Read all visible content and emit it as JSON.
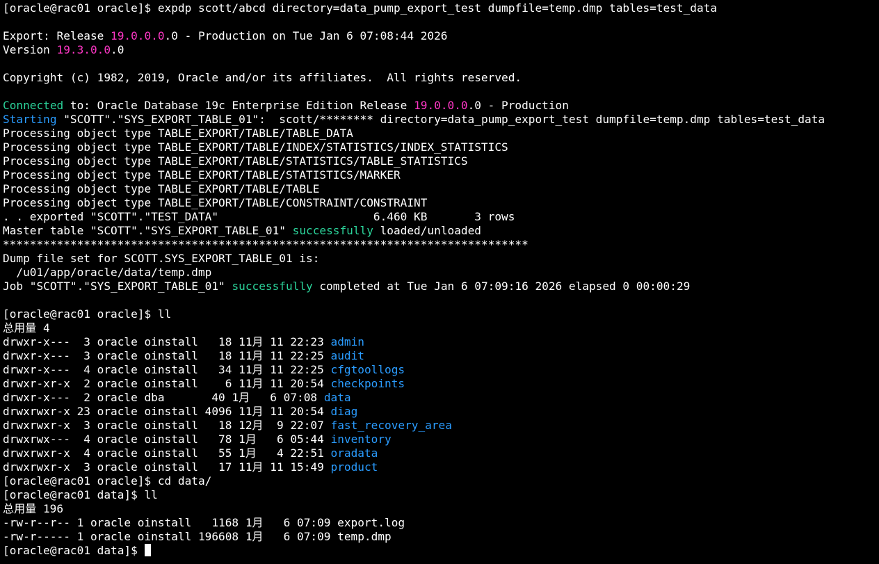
{
  "terminal": {
    "colors": {
      "background": "#000000",
      "default": "#ffffff",
      "magenta": "#ff37c6",
      "green": "#2bd39a",
      "blue": "#2a9cff"
    },
    "lines": [
      [
        {
          "t": "[oracle@rac01 oracle]$ expdp scott/abcd directory=data_pump_export_test dumpfile=temp.dmp tables=test_data"
        }
      ],
      [
        {
          "t": ""
        }
      ],
      [
        {
          "t": "Export: Release "
        },
        {
          "t": "19.0.0.0",
          "c": "magenta"
        },
        {
          "t": ".0 - Production on Tue Jan 6 07:08:44 2026"
        }
      ],
      [
        {
          "t": "Version "
        },
        {
          "t": "19.3.0.0",
          "c": "magenta"
        },
        {
          "t": ".0"
        }
      ],
      [
        {
          "t": ""
        }
      ],
      [
        {
          "t": "Copyright (c) 1982, 2019, Oracle and/or its affiliates.  All rights reserved."
        }
      ],
      [
        {
          "t": ""
        }
      ],
      [
        {
          "t": "Connected",
          "c": "green"
        },
        {
          "t": " to: Oracle Database 19c Enterprise Edition Release "
        },
        {
          "t": "19.0.0.0",
          "c": "magenta"
        },
        {
          "t": ".0 - Production"
        }
      ],
      [
        {
          "t": "Starting",
          "c": "blue"
        },
        {
          "t": " \"SCOTT\".\"SYS_EXPORT_TABLE_01\":  scott/******** directory=data_pump_export_test dumpfile=temp.dmp tables=test_data"
        }
      ],
      [
        {
          "t": "Processing object type TABLE_EXPORT/TABLE/TABLE_DATA"
        }
      ],
      [
        {
          "t": "Processing object type TABLE_EXPORT/TABLE/INDEX/STATISTICS/INDEX_STATISTICS"
        }
      ],
      [
        {
          "t": "Processing object type TABLE_EXPORT/TABLE/STATISTICS/TABLE_STATISTICS"
        }
      ],
      [
        {
          "t": "Processing object type TABLE_EXPORT/TABLE/STATISTICS/MARKER"
        }
      ],
      [
        {
          "t": "Processing object type TABLE_EXPORT/TABLE/TABLE"
        }
      ],
      [
        {
          "t": "Processing object type TABLE_EXPORT/TABLE/CONSTRAINT/CONSTRAINT"
        }
      ],
      [
        {
          "t": ". . exported \"SCOTT\".\"TEST_DATA\"                       6.460 KB       3 rows"
        }
      ],
      [
        {
          "t": "Master table \"SCOTT\".\"SYS_EXPORT_TABLE_01\" "
        },
        {
          "t": "successfully",
          "c": "green"
        },
        {
          "t": " loaded/unloaded"
        }
      ],
      [
        {
          "t": "******************************************************************************"
        }
      ],
      [
        {
          "t": "Dump file set for SCOTT.SYS_EXPORT_TABLE_01 is:"
        }
      ],
      [
        {
          "t": "  /u01/app/oracle/data/temp.dmp"
        }
      ],
      [
        {
          "t": "Job \"SCOTT\".\"SYS_EXPORT_TABLE_01\" "
        },
        {
          "t": "successfully",
          "c": "green"
        },
        {
          "t": " completed at Tue Jan 6 07:09:16 2026 elapsed 0 00:00:29"
        }
      ],
      [
        {
          "t": ""
        }
      ],
      [
        {
          "t": "[oracle@rac01 oracle]$ ll"
        }
      ],
      [
        {
          "t": "总用量 4"
        }
      ],
      [
        {
          "t": "drwxr-x---  3 oracle oinstall   18 11月 11 22:23 "
        },
        {
          "t": "admin",
          "c": "blue"
        }
      ],
      [
        {
          "t": "drwxr-x---  3 oracle oinstall   18 11月 11 22:25 "
        },
        {
          "t": "audit",
          "c": "blue"
        }
      ],
      [
        {
          "t": "drwxr-x---  4 oracle oinstall   34 11月 11 22:25 "
        },
        {
          "t": "cfgtoollogs",
          "c": "blue"
        }
      ],
      [
        {
          "t": "drwxr-xr-x  2 oracle oinstall    6 11月 11 20:54 "
        },
        {
          "t": "checkpoints",
          "c": "blue"
        }
      ],
      [
        {
          "t": "drwxr-x---  2 oracle dba       40 1月   6 07:08 "
        },
        {
          "t": "data",
          "c": "blue"
        }
      ],
      [
        {
          "t": "drwxrwxr-x 23 oracle oinstall 4096 11月 11 20:54 "
        },
        {
          "t": "diag",
          "c": "blue"
        }
      ],
      [
        {
          "t": "drwxrwxr-x  3 oracle oinstall   18 12月  9 22:07 "
        },
        {
          "t": "fast_recovery_area",
          "c": "blue"
        }
      ],
      [
        {
          "t": "drwxrwx---  4 oracle oinstall   78 1月   6 05:44 "
        },
        {
          "t": "inventory",
          "c": "blue"
        }
      ],
      [
        {
          "t": "drwxrwxr-x  4 oracle oinstall   55 1月   4 22:51 "
        },
        {
          "t": "oradata",
          "c": "blue"
        }
      ],
      [
        {
          "t": "drwxrwxr-x  3 oracle oinstall   17 11月 11 15:49 "
        },
        {
          "t": "product",
          "c": "blue"
        }
      ],
      [
        {
          "t": "[oracle@rac01 oracle]$ cd data/"
        }
      ],
      [
        {
          "t": "[oracle@rac01 data]$ ll"
        }
      ],
      [
        {
          "t": "总用量 196"
        }
      ],
      [
        {
          "t": "-rw-r--r-- 1 oracle oinstall   1168 1月   6 07:09 export.log"
        }
      ],
      [
        {
          "t": "-rw-r----- 1 oracle oinstall 196608 1月   6 07:09 temp.dmp"
        }
      ],
      [
        {
          "t": "[oracle@rac01 data]$ "
        }
      ]
    ],
    "cursor": {
      "visible": true
    }
  }
}
